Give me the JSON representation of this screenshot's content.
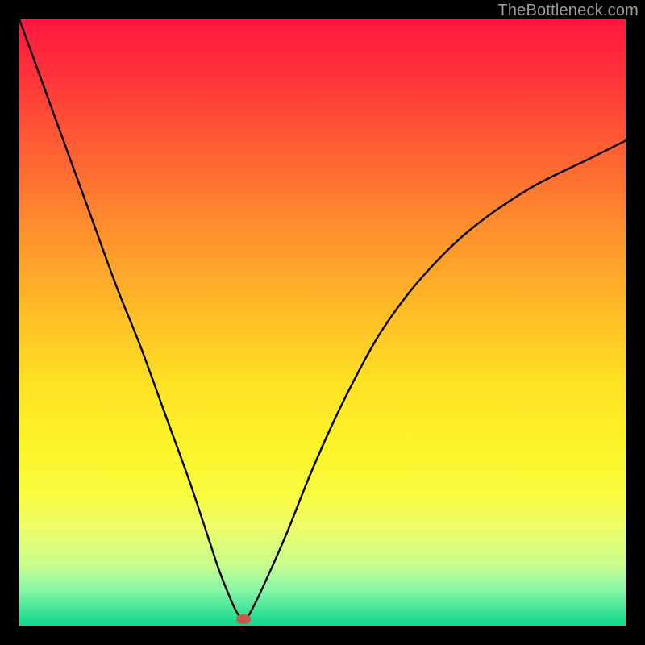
{
  "attribution": "TheBottleneck.com",
  "colors": {
    "frame_bg_top": "#ff163f",
    "frame_bg_bottom": "#16d98c",
    "page_bg": "#000000",
    "curve": "#000000",
    "marker": "#c75a4e",
    "attribution_text": "#9a9a9a"
  },
  "chart_data": {
    "type": "line",
    "title": "",
    "xlabel": "",
    "ylabel": "",
    "xlim": [
      0,
      100
    ],
    "ylim": [
      0,
      100
    ],
    "grid": false,
    "legend": false,
    "series": [
      {
        "name": "bottleneck-curve",
        "x": [
          0,
          4,
          8,
          12,
          16,
          20,
          24,
          28,
          31,
          33,
          35,
          36,
          37,
          38,
          40,
          44,
          48,
          52,
          56,
          60,
          66,
          74,
          84,
          94,
          100
        ],
        "y": [
          100,
          89,
          78,
          67,
          56,
          46,
          35,
          24,
          15,
          9,
          4,
          2,
          1,
          2,
          6,
          15,
          25,
          34,
          42,
          49,
          57,
          65,
          72,
          77,
          80
        ]
      }
    ],
    "marker": {
      "x": 37,
      "y": 1
    }
  }
}
